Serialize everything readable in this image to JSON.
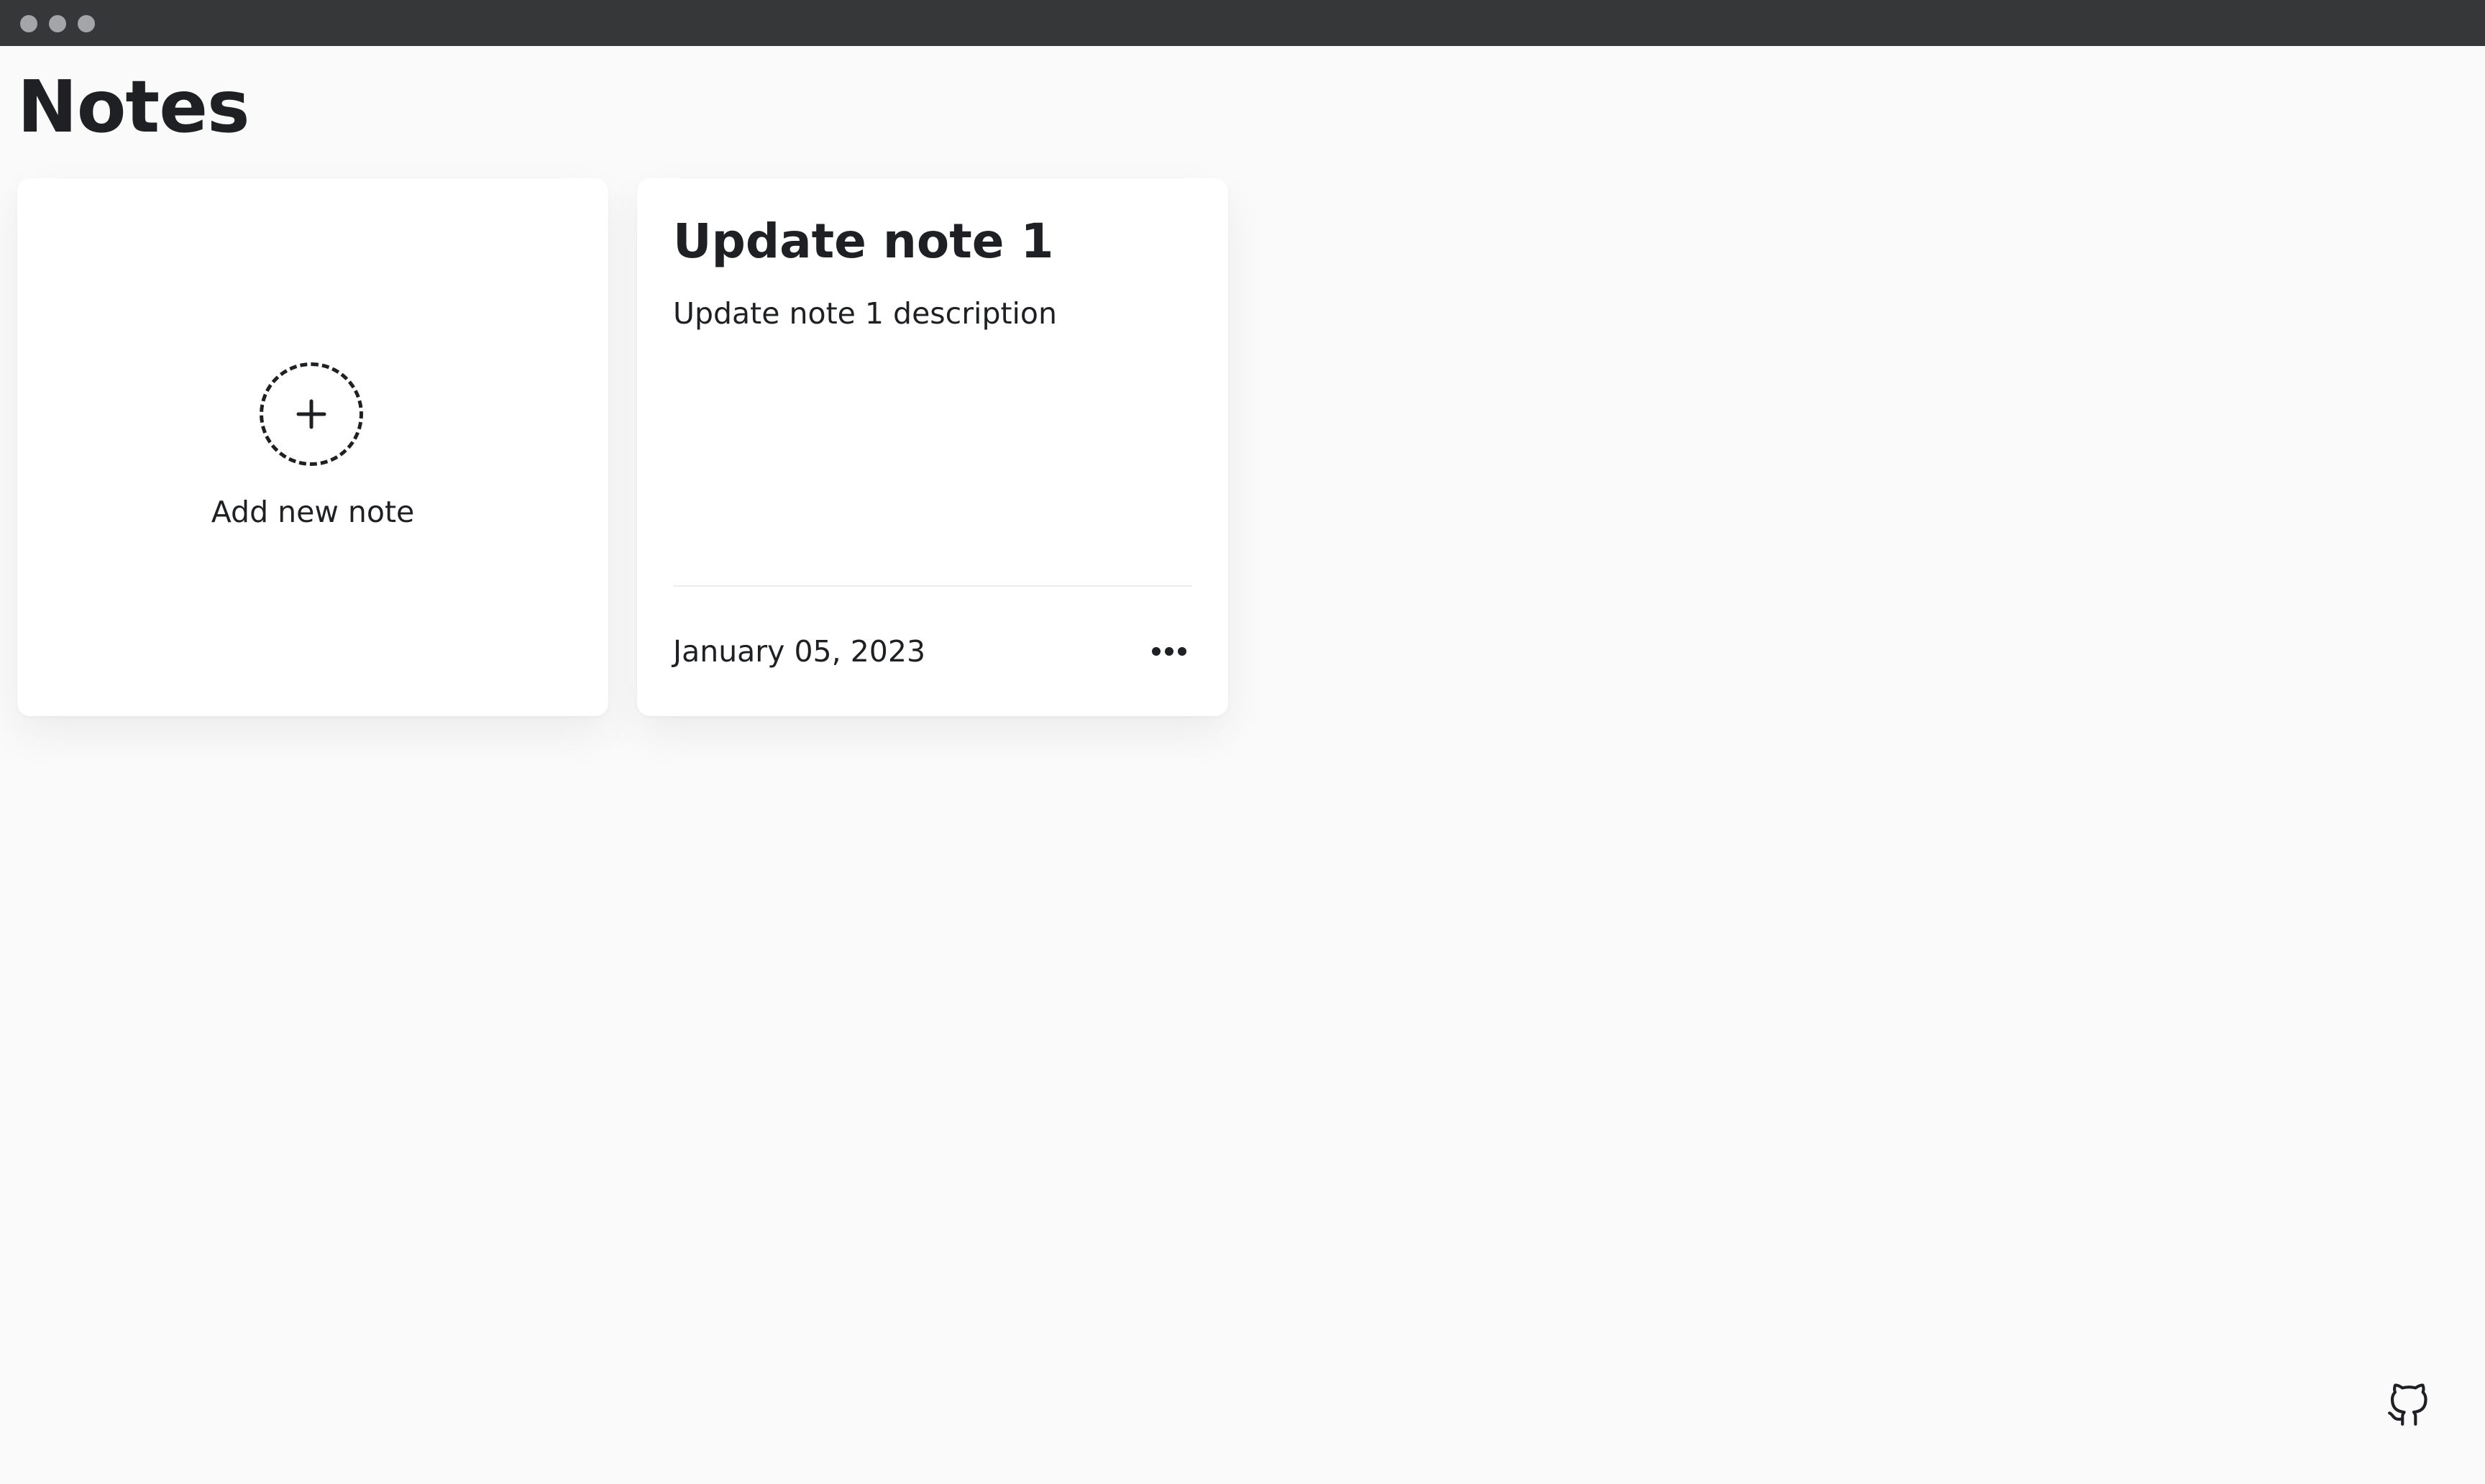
{
  "window": {
    "controls": [
      "close",
      "minimize",
      "maximize"
    ]
  },
  "page": {
    "title": "Notes"
  },
  "add_card": {
    "label": "Add new note",
    "icon": "plus-icon"
  },
  "notes": [
    {
      "title": "Update note 1",
      "description": "Update note 1 description",
      "date": "January 05, 2023",
      "menu_icon": "more-horizontal-icon"
    }
  ],
  "footer": {
    "icon": "github-icon"
  },
  "colors": {
    "titlebar": "#363739",
    "window_dot": "#a4a5a8",
    "background": "#fafafa",
    "card": "#ffffff",
    "text": "#1f2023",
    "divider": "#ececec"
  }
}
